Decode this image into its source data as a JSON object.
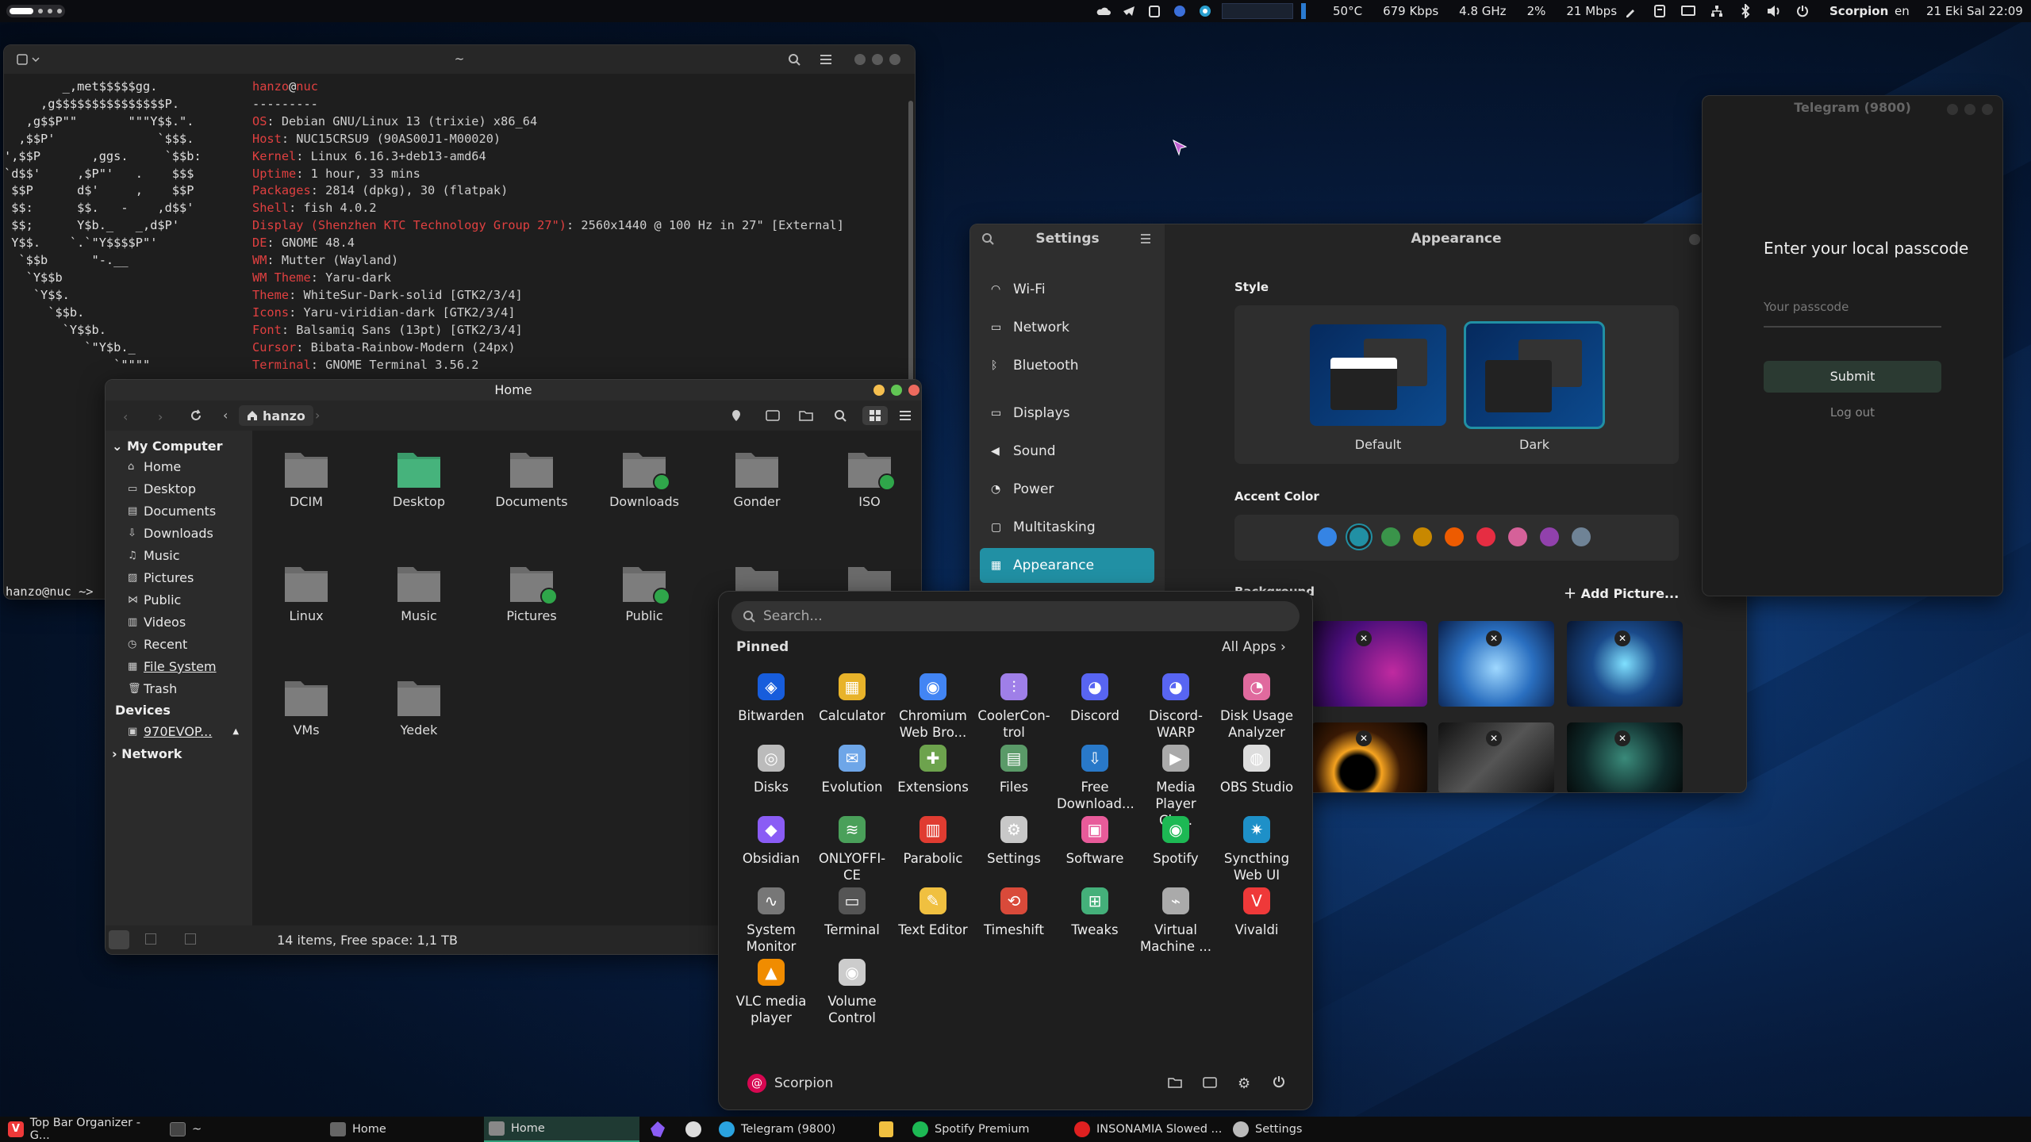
{
  "topbar": {
    "temp": "50°C",
    "net_speed": "679 Kbps",
    "cpu_freq": "4.8 GHz",
    "cpu_pct": "2%",
    "net2": "21 Mbps",
    "user": "Scorpion",
    "lang": "en",
    "datetime": "21 Eki Sal 22:09"
  },
  "terminal": {
    "title": "~",
    "logo": [
      "        _,met$$$$$gg.",
      "     ,g$$$$$$$$$$$$$$$P.",
      "   ,g$$P\"\"       \"\"\"Y$$.\".",
      "  ,$$P'              `$$$.",
      "',$$P       ,ggs.     `$$b:",
      "`d$$'     ,$P\"'   .    $$$",
      " $$P      d$'     ,    $$P",
      " $$:      $$.   -    ,d$$'",
      " $$;      Y$b._   _,d$P'",
      " Y$$.    `.`\"Y$$$$P\"'",
      "  `$$b      \"-.__",
      "   `Y$$b",
      "    `Y$$.",
      "      `$$b.",
      "        `Y$$b.",
      "           `\"Y$b._",
      "               `\"\"\"\""
    ],
    "user": "hanzo",
    "host": "nuc",
    "sep": "---------",
    "info": [
      [
        "OS",
        ": Debian GNU/Linux 13 (trixie) x86_64"
      ],
      [
        "Host",
        ": NUC15CRSU9 (90AS00J1-M00020)"
      ],
      [
        "Kernel",
        ": Linux 6.16.3+deb13-amd64"
      ],
      [
        "Uptime",
        ": 1 hour, 33 mins"
      ],
      [
        "Packages",
        ": 2814 (dpkg), 30 (flatpak)"
      ],
      [
        "Shell",
        ": fish 4.0.2"
      ],
      [
        "Display (Shenzhen KTC Technology Group 27\")",
        ": 2560x1440 @ 100 Hz in 27\" [External]"
      ],
      [
        "DE",
        ": GNOME 48.4"
      ],
      [
        "WM",
        ": Mutter (Wayland)"
      ],
      [
        "WM Theme",
        ": Yaru-dark"
      ],
      [
        "Theme",
        ": WhiteSur-Dark-solid [GTK2/3/4]"
      ],
      [
        "Icons",
        ": Yaru-viridian-dark [GTK2/3/4]"
      ],
      [
        "Font",
        ": Balsamiq Sans (13pt) [GTK2/3/4]"
      ],
      [
        "Cursor",
        ": Bibata-Rainbow-Modern (24px)"
      ],
      [
        "Terminal",
        ": GNOME Terminal 3.56.2"
      ]
    ],
    "prompt": "hanzo@nuc ~>"
  },
  "files": {
    "title": "Home",
    "path": "hanzo",
    "side_head": "My Computer",
    "side_items": [
      "Home",
      "Desktop",
      "Documents",
      "Downloads",
      "Music",
      "Pictures",
      "Public",
      "Videos",
      "Recent",
      "File System",
      "Trash"
    ],
    "devices_head": "Devices",
    "device": "970EVOP...",
    "network_head": "Network",
    "folders": [
      "DCIM",
      "Desktop",
      "Documents",
      "Downloads",
      "Gonder",
      "ISO",
      "Linux",
      "Music",
      "Pictures",
      "Public",
      "VMs",
      "Yedek"
    ],
    "status": "14 items, Free space: 1,1 TB"
  },
  "settings": {
    "sidebar_title": "Settings",
    "page_title": "Appearance",
    "items": [
      "Wi-Fi",
      "Network",
      "Bluetooth",
      "Displays",
      "Sound",
      "Power",
      "Multitasking",
      "Appearance"
    ],
    "style_label": "Style",
    "default_label": "Default",
    "dark_label": "Dark",
    "accent_label": "Accent Color",
    "accents": [
      "#3584e4",
      "#2190a4",
      "#3a944a",
      "#c88800",
      "#ed5b00",
      "#e62d42",
      "#d56199",
      "#9141ac",
      "#6f8396"
    ],
    "bg_label": "Background",
    "add_picture": "Add Picture..."
  },
  "telegram": {
    "title": "Telegram (9800)",
    "heading": "Enter your local passcode",
    "placeholder": "Your passcode",
    "submit": "Submit",
    "logout": "Log out"
  },
  "appmenu": {
    "search_placeholder": "Search...",
    "pinned": "Pinned",
    "all_apps": "All Apps",
    "user": "Scorpion",
    "apps": [
      {
        "l1": "Bitwarden",
        "l2": "",
        "c": "#175ddc",
        "g": "◈"
      },
      {
        "l1": "Calculator",
        "l2": "",
        "c": "#e8b32a",
        "g": "▦"
      },
      {
        "l1": "Chromium",
        "l2": "Web Bro...",
        "c": "#4285f4",
        "g": "◉"
      },
      {
        "l1": "CoolerCon-",
        "l2": "trol",
        "c": "#9f7fe8",
        "g": "⫶"
      },
      {
        "l1": "Discord",
        "l2": "",
        "c": "#5865f2",
        "g": "◕"
      },
      {
        "l1": "Discord-",
        "l2": "WARP",
        "c": "#5865f2",
        "g": "◕"
      },
      {
        "l1": "Disk Usage",
        "l2": "Analyzer",
        "c": "#e06a9e",
        "g": "◔"
      },
      {
        "l1": "Disks",
        "l2": "",
        "c": "#bbbbbb",
        "g": "◎"
      },
      {
        "l1": "Evolution",
        "l2": "",
        "c": "#6ea6e8",
        "g": "✉"
      },
      {
        "l1": "Extensions",
        "l2": "",
        "c": "#6da34d",
        "g": "✚"
      },
      {
        "l1": "Files",
        "l2": "",
        "c": "#5a9a68",
        "g": "▤"
      },
      {
        "l1": "Free",
        "l2": "Download...",
        "c": "#2979c9",
        "g": "⇩"
      },
      {
        "l1": "Media",
        "l2": "Player Cla...",
        "c": "#aaaaaa",
        "g": "▶"
      },
      {
        "l1": "OBS Studio",
        "l2": "",
        "c": "#dddddd",
        "g": "◍"
      },
      {
        "l1": "Obsidian",
        "l2": "",
        "c": "#8a5cf5",
        "g": "◆"
      },
      {
        "l1": "ONLYOFFI-",
        "l2": "CE",
        "c": "#4aa05a",
        "g": "≋"
      },
      {
        "l1": "Parabolic",
        "l2": "",
        "c": "#e03c31",
        "g": "▥"
      },
      {
        "l1": "Settings",
        "l2": "",
        "c": "#c8c8c8",
        "g": "⚙"
      },
      {
        "l1": "Software",
        "l2": "",
        "c": "#e85b9a",
        "g": "▣"
      },
      {
        "l1": "Spotify",
        "l2": "",
        "c": "#1db954",
        "g": "◉"
      },
      {
        "l1": "Syncthing",
        "l2": "Web UI",
        "c": "#1e90c8",
        "g": "✷"
      },
      {
        "l1": "System",
        "l2": "Monitor",
        "c": "#777777",
        "g": "∿"
      },
      {
        "l1": "Terminal",
        "l2": "",
        "c": "#555555",
        "g": "▭"
      },
      {
        "l1": "Text Editor",
        "l2": "",
        "c": "#f0c040",
        "g": "✎"
      },
      {
        "l1": "Timeshift",
        "l2": "",
        "c": "#d94a3a",
        "g": "⟲"
      },
      {
        "l1": "Tweaks",
        "l2": "",
        "c": "#44b07a",
        "g": "⊞"
      },
      {
        "l1": "Virtual",
        "l2": "Machine ...",
        "c": "#aaaaaa",
        "g": "⌁"
      },
      {
        "l1": "Vivaldi",
        "l2": "",
        "c": "#ef3939",
        "g": "V"
      },
      {
        "l1": "VLC media",
        "l2": "player",
        "c": "#f08c00",
        "g": "▲"
      },
      {
        "l1": "Volume",
        "l2": "Control",
        "c": "#cccccc",
        "g": "◉"
      }
    ]
  },
  "taskbar": {
    "items": [
      "Top Bar Organizer - G...",
      "~",
      "Home",
      "Home",
      "Telegram (9800)",
      "Spotify Premium",
      "INSONAMIA Slowed ...",
      "Settings"
    ]
  }
}
